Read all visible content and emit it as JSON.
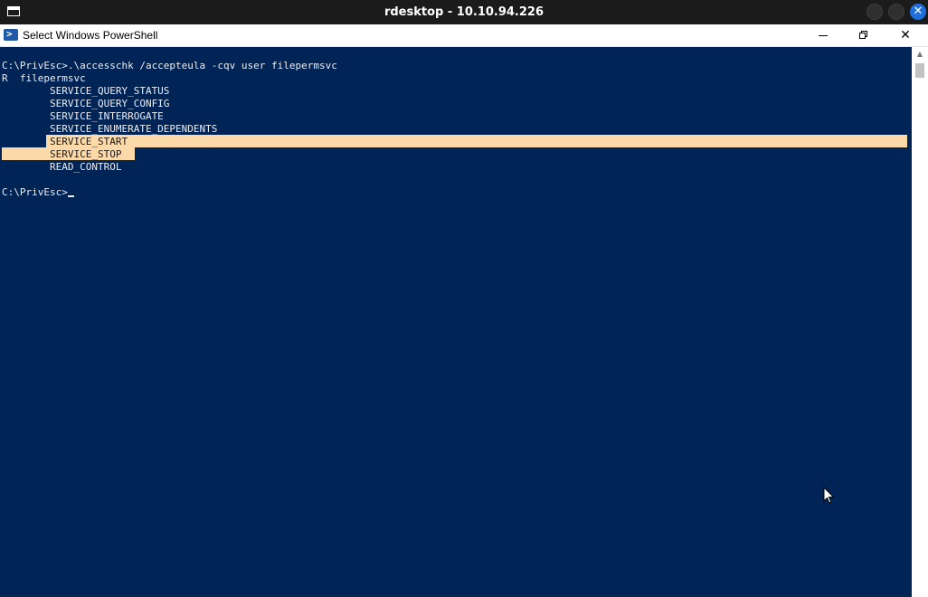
{
  "rdesktop": {
    "title": "rdesktop - 10.10.94.226"
  },
  "window": {
    "title": "Select Windows PowerShell",
    "icon": "powershell-icon"
  },
  "console": {
    "lines": [
      "C:\\PrivEsc>.\\accesschk /accepteula -cqv user filepermsvc",
      "R  filepermsvc",
      "        SERVICE_QUERY_STATUS",
      "        SERVICE_QUERY_CONFIG",
      "        SERVICE_INTERROGATE",
      "        SERVICE_ENUMERATE_DEPENDENTS",
      "        SERVICE_START",
      "        SERVICE_STOP",
      "        READ_CONTROL",
      "",
      "C:\\PrivEsc>"
    ],
    "background": "#012456",
    "foreground": "#eeedf0",
    "selection_color": "#fcd9a8"
  }
}
